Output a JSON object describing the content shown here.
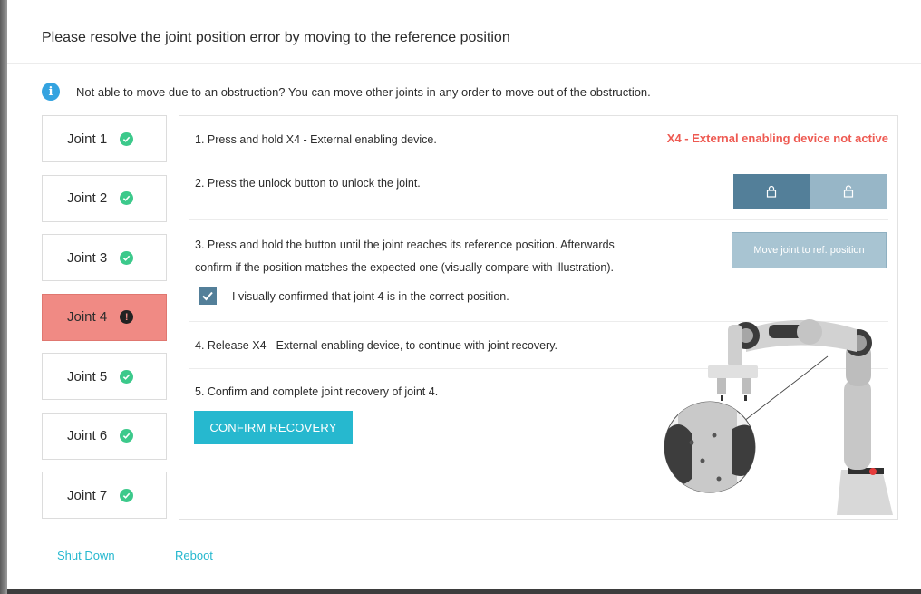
{
  "dialog": {
    "title": "Please resolve the joint position error by moving to the reference position",
    "info_text": "Not able to move due to an obstruction? You can move other joints in any order to move out of the obstruction."
  },
  "joints": [
    {
      "label": "Joint 1",
      "status": "ok"
    },
    {
      "label": "Joint 2",
      "status": "ok"
    },
    {
      "label": "Joint 3",
      "status": "ok"
    },
    {
      "label": "Joint 4",
      "status": "error"
    },
    {
      "label": "Joint 5",
      "status": "ok"
    },
    {
      "label": "Joint 6",
      "status": "ok"
    },
    {
      "label": "Joint 7",
      "status": "ok"
    }
  ],
  "steps": {
    "step1": "1. Press and hold X4 - External enabling device.",
    "step1_error": "X4 - External enabling device not active",
    "step2": "2. Press the unlock button to unlock the joint.",
    "step3_line1": "3. Press and hold the button until the joint reaches its reference position. Afterwards",
    "step3_line2": "confirm if the position matches the expected one (visually compare with illustration).",
    "move_button": "Move joint to ref. position",
    "checkbox_label": "I visually confirmed that joint 4 is in the correct position.",
    "checkbox_checked": true,
    "step4": "4. Release X4 - External enabling device, to continue with joint recovery.",
    "step5": "5. Confirm and complete joint recovery of joint 4.",
    "confirm_button": "CONFIRM RECOVERY"
  },
  "icons": {
    "info": "info-icon",
    "ok": "check-circle-icon",
    "error": "exclamation-circle-icon",
    "lock": "lock-icon",
    "unlock": "unlock-icon"
  },
  "footer": {
    "shutdown": "Shut Down",
    "reboot": "Reboot"
  },
  "colors": {
    "accent": "#26b8cf",
    "error": "#ee5a52",
    "ok": "#3cc98b",
    "active_joint": "#f08a84",
    "lock_dark": "#537f99",
    "lock_light": "#97b6c7"
  }
}
